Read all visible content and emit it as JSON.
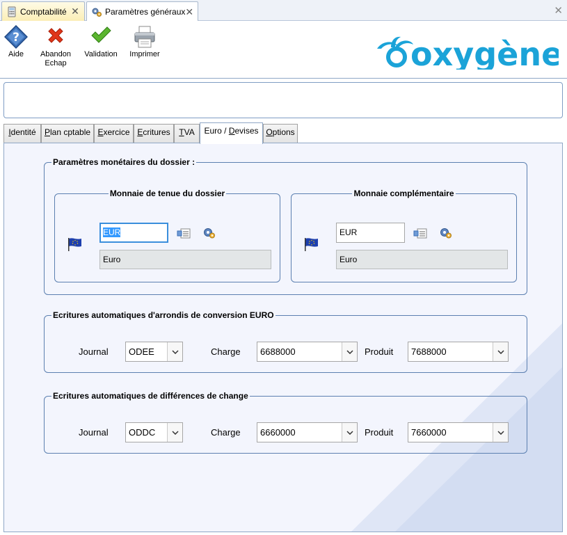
{
  "doc_tabs": [
    {
      "label": "Comptabilité"
    },
    {
      "label": "Paramètres généraux"
    }
  ],
  "toolbar": {
    "aide": "Aide",
    "abandon_line1": "Abandon",
    "abandon_line2": "Echap",
    "validation": "Validation",
    "imprimer": "Imprimer"
  },
  "brand": {
    "logo_text": "oxygène",
    "accent": "#1ba3d8"
  },
  "tabs": [
    {
      "label": "Identité",
      "key": "I",
      "rest": "dentité"
    },
    {
      "label": "Plan cptable",
      "key": "P",
      "rest": "lan cptable"
    },
    {
      "label": "Exercice",
      "key": "E",
      "rest": "xercice"
    },
    {
      "label": "Ecritures",
      "key": "E",
      "rest": "critures"
    },
    {
      "label": "TVA",
      "key": "T",
      "rest": "VA"
    },
    {
      "label": "Euro / Devises",
      "pre": "Euro / ",
      "key": "D",
      "rest": "evises"
    },
    {
      "label": "Options",
      "key": "O",
      "rest": "ptions"
    }
  ],
  "active_tab": "Euro / Devises",
  "params": {
    "title": "Paramètres monétaires du dossier :",
    "tenue": {
      "title": "Monnaie de tenue du dossier",
      "code": "EUR",
      "name": "Euro"
    },
    "complementaire": {
      "title": "Monnaie complémentaire",
      "code": "EUR",
      "name": "Euro"
    }
  },
  "arrondis": {
    "title": "Ecritures automatiques d'arrondis de conversion EURO",
    "journal_label": "Journal",
    "journal": "ODEE",
    "charge_label": "Charge",
    "charge": "6688000",
    "produit_label": "Produit",
    "produit": "7688000"
  },
  "change": {
    "title": "Ecritures automatiques de différences de change",
    "journal_label": "Journal",
    "journal": "ODDC",
    "charge_label": "Charge",
    "charge": "6660000",
    "produit_label": "Produit",
    "produit": "7660000"
  }
}
